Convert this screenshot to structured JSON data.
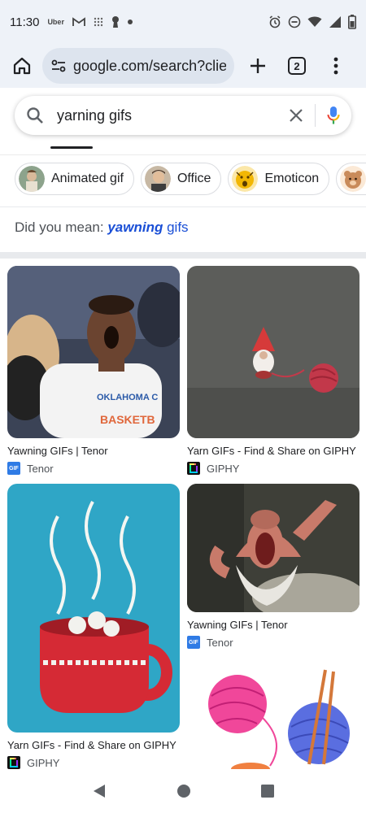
{
  "status_bar": {
    "time": "11:30",
    "left_icons": [
      "uber-icon",
      "gmail-icon",
      "grid-dots-icon",
      "keyhole-icon",
      "dot-icon"
    ],
    "uber_label": "Uber",
    "right_icons": [
      "alarm-icon",
      "do-not-disturb-icon",
      "wifi-icon",
      "signal-icon",
      "battery-icon"
    ]
  },
  "toolbar": {
    "url": "google.com/search?clier",
    "tab_count": "2"
  },
  "search": {
    "query": "yarning gifs"
  },
  "chips": [
    {
      "label": "Animated gif",
      "thumb_color": "#8da38c"
    },
    {
      "label": "Office",
      "thumb_color": "#b48a6a"
    },
    {
      "label": "Emoticon",
      "thumb_color": "#f2b705"
    },
    {
      "label": "",
      "thumb_color": "#c98b5a"
    }
  ],
  "did_you_mean": {
    "prefix": "Did you mean: ",
    "corrected_bold": "yawning",
    "rest": " gifs"
  },
  "results": [
    {
      "title": "Yawning GIFs | Tenor",
      "source": "Tenor",
      "favicon": "tenor-icon",
      "image": "basketball-player-yawning-image",
      "jersey_line1": "OKLAHOMA C",
      "jersey_line2": "BASKETB"
    },
    {
      "title": "Yarn GIFs - Find & Share on GIPHY",
      "source": "GIPHY",
      "favicon": "giphy-icon",
      "image": "gnome-with-yarn-ball-image"
    },
    {
      "title": "Yarn GIFs - Find & Share on GIPHY",
      "source": "GIPHY",
      "favicon": "giphy-icon",
      "image": "knitted-hot-cocoa-mug-image"
    },
    {
      "title": "Yawning GIFs | Tenor",
      "source": "Tenor",
      "favicon": "tenor-icon",
      "image": "dwarf-yawning-image"
    },
    {
      "title": "",
      "source": "",
      "favicon": "",
      "image": "yarn-balls-with-needles-image"
    }
  ],
  "tenor_favicon_text": "GIF",
  "colors": {
    "accent_blue": "#1a4fd6",
    "mic_blue": "#4285f4",
    "mic_red": "#ea4335"
  }
}
